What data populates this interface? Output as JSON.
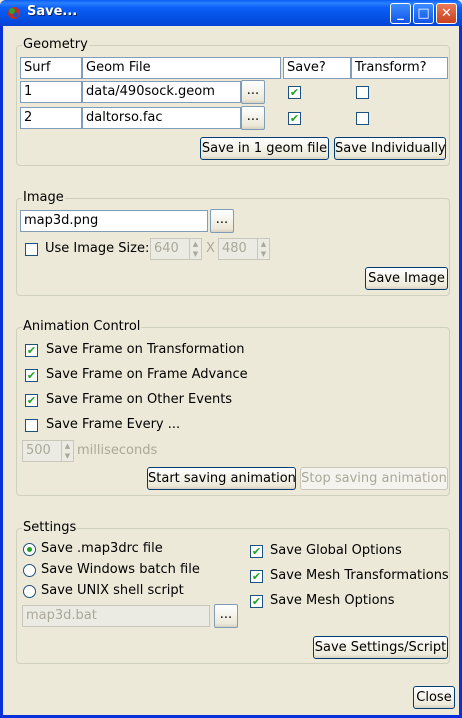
{
  "window": {
    "title": "Save...",
    "minimize_label": "_",
    "maximize_label": "□",
    "close_label": "✕"
  },
  "geometry": {
    "label": "Geometry",
    "headers": {
      "surf": "Surf",
      "file": "Geom File",
      "save": "Save?",
      "transform": "Transform?"
    },
    "rows": [
      {
        "surf": "1",
        "file": "data/490sock.geom",
        "save": true,
        "transform": false
      },
      {
        "surf": "2",
        "file": "daltorso.fac",
        "save": true,
        "transform": false
      }
    ],
    "browse_label": "...",
    "save_one_label": "Save in 1 geom file",
    "save_individually_label": "Save Individually"
  },
  "image": {
    "label": "Image",
    "filename": "map3d.png",
    "browse_label": "...",
    "use_size_label": "Use Image Size:",
    "use_size_checked": false,
    "width": "640",
    "x_label": "X",
    "height": "480",
    "save_label": "Save Image"
  },
  "animation": {
    "label": "Animation Control",
    "options": [
      {
        "label": "Save Frame on Transformation",
        "checked": true
      },
      {
        "label": "Save Frame on Frame Advance",
        "checked": true
      },
      {
        "label": "Save Frame on Other Events",
        "checked": true
      },
      {
        "label": "Save Frame Every ...",
        "checked": false
      }
    ],
    "interval": "500",
    "interval_unit": "milliseconds",
    "start_label": "Start saving animation",
    "stop_label": "Stop saving animation"
  },
  "settings": {
    "label": "Settings",
    "radios": [
      {
        "label": "Save .map3drc file",
        "selected": true
      },
      {
        "label": "Save Windows batch file",
        "selected": false
      },
      {
        "label": "Save UNIX shell script",
        "selected": false
      }
    ],
    "checks": [
      {
        "label": "Save Global Options",
        "checked": true
      },
      {
        "label": "Save Mesh Transformations",
        "checked": true
      },
      {
        "label": "Save Mesh Options",
        "checked": true
      }
    ],
    "script_file": "map3d.bat",
    "browse_label": "...",
    "save_label": "Save Settings/Script"
  },
  "close_label": "Close",
  "colors": {
    "titlebar": "#0a5ef7",
    "check": "#21a121",
    "face": "#ece9d8"
  }
}
